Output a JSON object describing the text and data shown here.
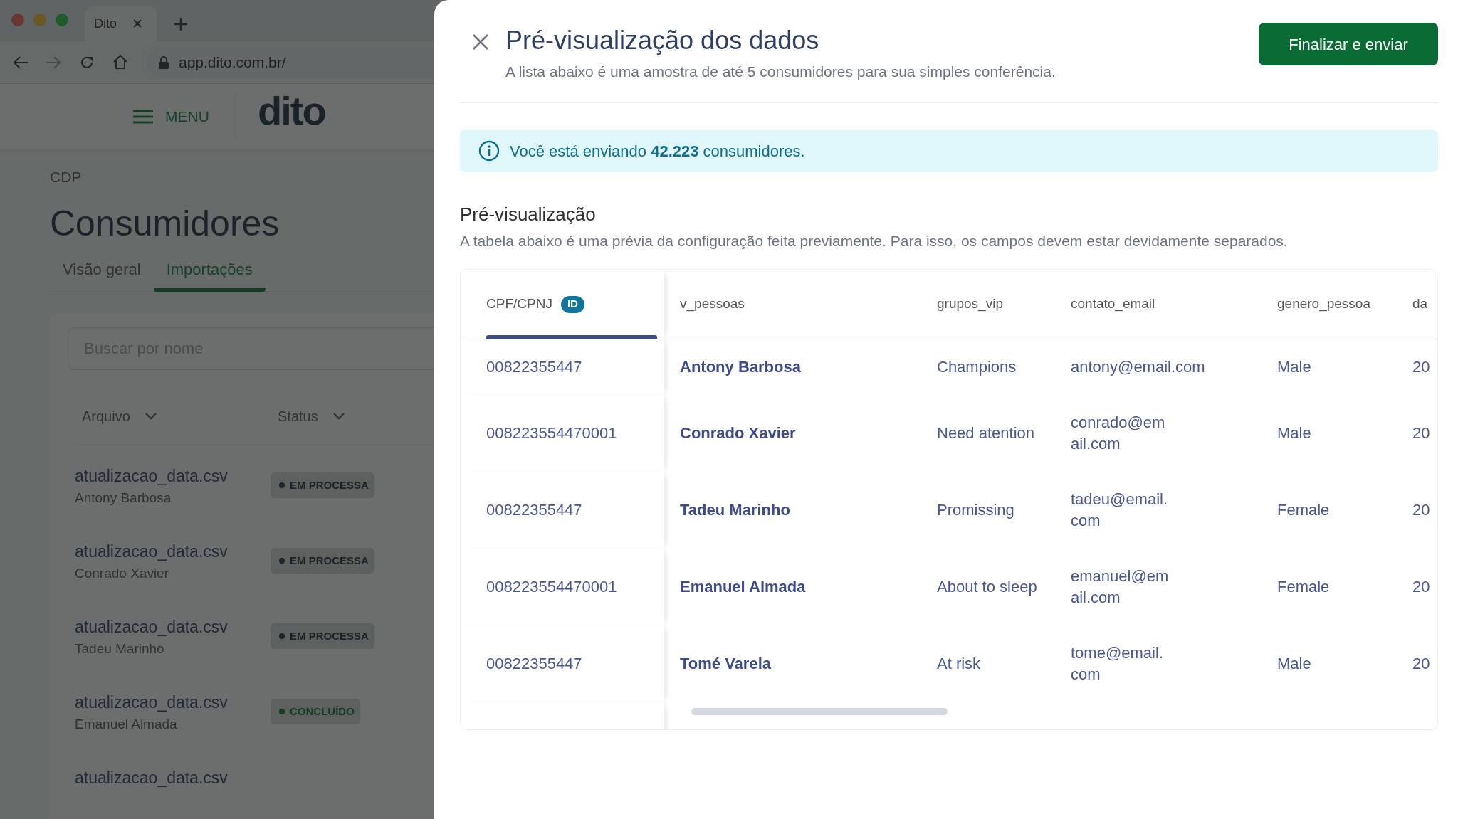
{
  "browser": {
    "tab_title": "Dito",
    "url": "app.dito.com.br/"
  },
  "app": {
    "menu_label": "MENU",
    "logo": "dito"
  },
  "page": {
    "breadcrumb": "CDP",
    "title": "Consumidores",
    "tabs": [
      {
        "label": "Visão geral",
        "selected": false
      },
      {
        "label": "Importações",
        "selected": true
      }
    ],
    "search": {
      "placeholder": "Buscar por nome"
    },
    "columns": [
      "Arquivo",
      "Status"
    ],
    "imports": [
      {
        "file": "atualizacao_data.csv",
        "user": "Antony Barbosa",
        "status": "EM PROCESSA",
        "color": "#1c2428"
      },
      {
        "file": "atualizacao_data.csv",
        "user": "Conrado Xavier",
        "status": "EM PROCESSA",
        "color": "#1c2428"
      },
      {
        "file": "atualizacao_data.csv",
        "user": "Tadeu Marinho",
        "status": "EM PROCESSA",
        "color": "#1c2428"
      },
      {
        "file": "atualizacao_data.csv",
        "user": "Emanuel Almada",
        "status": "CONCLUÍDO",
        "color": "#153a26"
      },
      {
        "file": "atualizacao_data.csv"
      }
    ]
  },
  "modal": {
    "title": "Pré-visualização dos dados",
    "subtitle": "A lista abaixo é uma amostra de até 5 consumidores para sua simples conferência.",
    "primary_button": "Finalizar e enviar",
    "banner": "Você está enviando **42.223** consumidores.",
    "section_title": "Pré-visualização",
    "section_description": "A tabela abaixo é uma prévia da configuração feita previamente. Para isso, os campos devem estar devidamente separados.",
    "table": {
      "columns": [
        {
          "label": "CPF/CPNJ",
          "badge": "ID",
          "kind": "id"
        },
        {
          "label": "v_pessoas",
          "kind": "name"
        },
        {
          "label": "grupos_vip",
          "kind": "text"
        },
        {
          "label": "contato_email",
          "kind": "text"
        },
        {
          "label": "genero_pessoa",
          "kind": "text"
        },
        {
          "label": "da",
          "kind": "text"
        }
      ],
      "rows": [
        {
          "cells": [
            "00822355447",
            "Antony Barbosa",
            "Champions",
            "antony@email.com",
            "Male",
            "20"
          ]
        },
        {
          "cells": [
            "008223554470001",
            "Conrado Xavier",
            "Need atention",
            "conrado@em\nail.com",
            "Male",
            "20"
          ]
        },
        {
          "cells": [
            "00822355447",
            "Tadeu Marinho",
            "Promissing",
            "tadeu@email.\ncom",
            "Female",
            "20"
          ]
        },
        {
          "cells": [
            "008223554470001",
            "Emanuel Almada",
            "About to sleep",
            "emanuel@em\nail.com",
            "Female",
            "20"
          ]
        },
        {
          "cells": [
            "00822355447",
            "Tomé Varela",
            "At risk",
            "tome@email.\ncom",
            "Male",
            "20"
          ]
        }
      ]
    }
  }
}
